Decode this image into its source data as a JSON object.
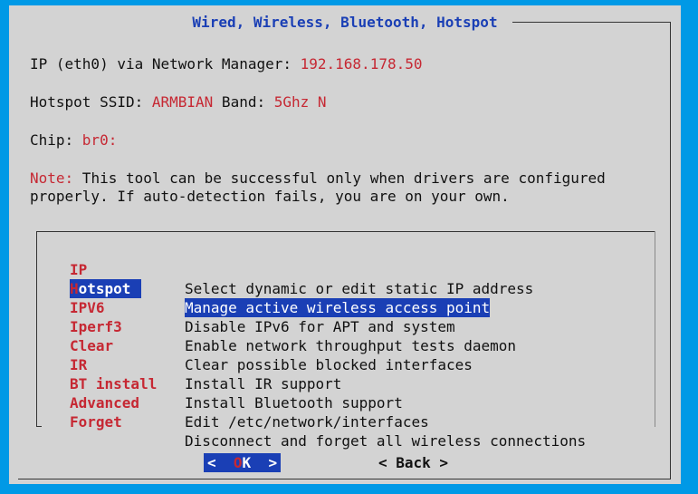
{
  "dialog": {
    "title": "Wired, Wireless, Bluetooth, Hotspot",
    "ip_label": "IP (eth0) via Network Manager: ",
    "ip_value": "192.168.178.50",
    "ssid_label": "Hotspot SSID: ",
    "ssid_value": "ARMBIAN",
    "band_label": " Band: ",
    "band_value": "5Ghz N",
    "chip_label": "Chip: ",
    "chip_value": "br0:",
    "note_label": "Note:",
    "note_line1": " This tool can be successful only when drivers are configured",
    "note_line2": "properly. If auto-detection fails, you are on your own."
  },
  "menu": {
    "items": [
      {
        "tag": "IP",
        "desc": "Select dynamic or edit static IP address"
      },
      {
        "tag": "Hotspot",
        "tag_first": "H",
        "tag_rest": "otspot",
        "desc": "Manage active wireless access point",
        "selected": true
      },
      {
        "tag": "IPV6",
        "desc": "Disable IPv6 for APT and system"
      },
      {
        "tag": "Iperf3",
        "desc": "Enable network throughput tests daemon"
      },
      {
        "tag": "Clear",
        "desc": "Clear possible blocked interfaces"
      },
      {
        "tag": "IR",
        "desc": "Install IR support"
      },
      {
        "tag": "BT install",
        "desc": "Install Bluetooth support"
      },
      {
        "tag": "Advanced",
        "desc": "Edit /etc/network/interfaces"
      },
      {
        "tag": "Forget",
        "desc": "Disconnect and forget all wireless connections"
      }
    ]
  },
  "buttons": {
    "ok_left": "<  ",
    "ok_hot": "O",
    "ok_right": "K  >",
    "back": "< Back >"
  },
  "colors": {
    "background": "#0099e6",
    "dialog": "#d3d3d3",
    "title": "#1a3fb5",
    "highlight": "#1a3fb5",
    "accent_red": "#c62833"
  }
}
